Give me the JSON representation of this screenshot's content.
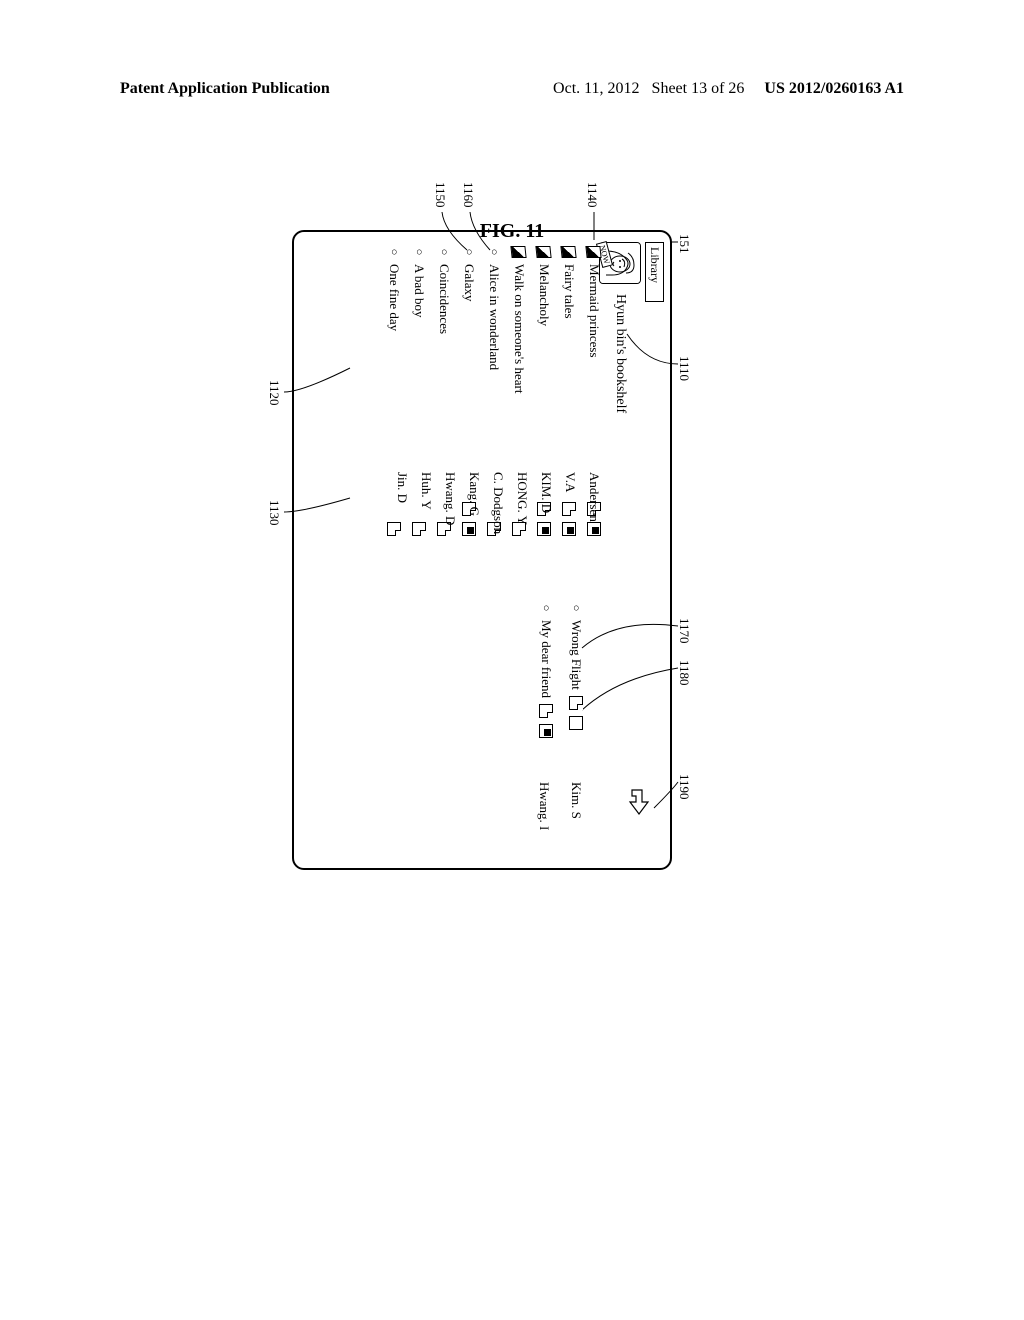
{
  "header": {
    "left": "Patent Application Publication",
    "date": "Oct. 11, 2012",
    "sheet": "Sheet 13 of 26",
    "pubno": "US 2012/0260163 A1"
  },
  "fig_label": "FIG. 11",
  "titlebar": "Library",
  "shelf_title": "Hyun bin's bookshelf",
  "books_left": [
    {
      "marker": "open",
      "title": "Mermaid princess",
      "note": true,
      "thumb": "dark",
      "author": "Andersen"
    },
    {
      "marker": "open",
      "title": "Fairy tales",
      "note": true,
      "thumb": "dark",
      "author": "V.A"
    },
    {
      "marker": "open",
      "title": "Melancholy",
      "note": true,
      "thumb": "dark",
      "author": "KIM. D"
    },
    {
      "marker": "open",
      "title": "Walk on someone's heart",
      "note": true,
      "thumb": null,
      "author": "HONG. Y"
    },
    {
      "marker": "circle",
      "title": "Alice in wonderland",
      "note": true,
      "thumb": null,
      "author": "C. Dodgson"
    },
    {
      "marker": "circle",
      "title": "Galaxy",
      "note": true,
      "thumb": "dark",
      "author": "Kang. G"
    },
    {
      "marker": "circle",
      "title": "Coincidences",
      "note": true,
      "thumb": null,
      "author": "Hwang. D"
    },
    {
      "marker": "circle",
      "title": "A bad boy",
      "note": true,
      "thumb": null,
      "author": "Huh. Y"
    },
    {
      "marker": "circle",
      "title": "One fine day",
      "note": true,
      "thumb": null,
      "author": "Jin. D"
    }
  ],
  "books_right": [
    {
      "marker": "circle",
      "title": "Wrong Flight",
      "note": true,
      "thumb": "light",
      "author": "Kim. S"
    },
    {
      "marker": "circle",
      "title": "My dear friend",
      "note": true,
      "thumb": "dark",
      "author": "Hwang. I"
    }
  ],
  "refs": {
    "r151": "151",
    "r1110": "1110",
    "r1120": "1120",
    "r1130": "1130",
    "r1140": "1140",
    "r1150": "1150",
    "r1160": "1160",
    "r1170": "1170",
    "r1180": "1180",
    "r1190": "1190"
  },
  "now_label": "NOW"
}
